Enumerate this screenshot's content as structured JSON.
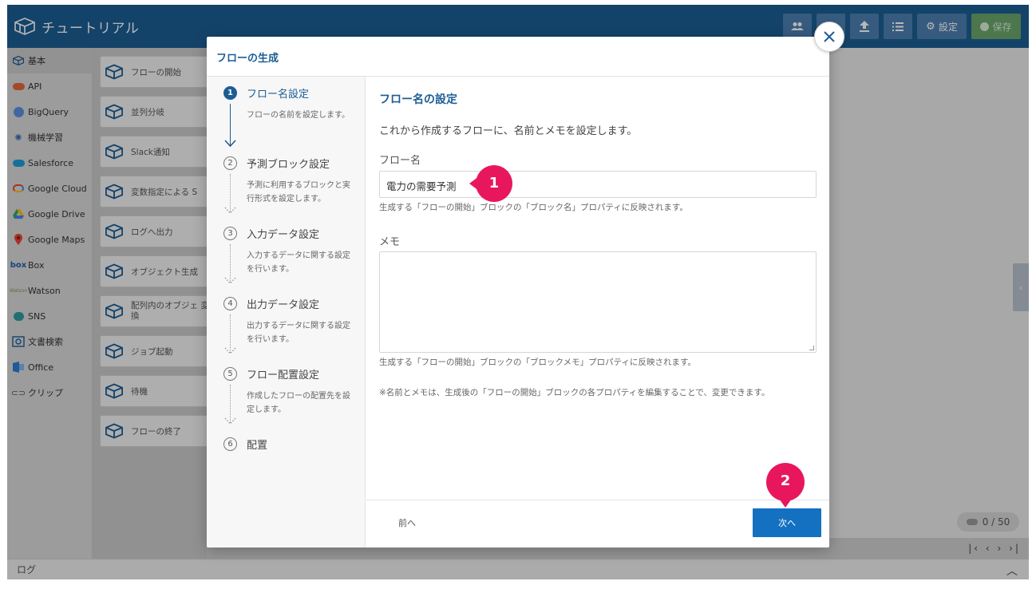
{
  "app": {
    "title": "チュートリアル",
    "toolbar": {
      "settings_label": "設定",
      "save_label": "保存"
    }
  },
  "sidebar": {
    "categories": [
      {
        "label": "基本",
        "icon": "hex-logo-icon"
      },
      {
        "label": "API",
        "icon": "cloud-api-icon"
      },
      {
        "label": "BigQuery",
        "icon": "bigquery-icon"
      },
      {
        "label": "機械学習",
        "icon": "brain-icon"
      },
      {
        "label": "Salesforce",
        "icon": "salesforce-cloud-icon"
      },
      {
        "label": "Google Cloud",
        "icon": "google-cloud-icon"
      },
      {
        "label": "Google Drive",
        "icon": "google-drive-icon"
      },
      {
        "label": "Google Maps",
        "icon": "map-pin-icon"
      },
      {
        "label": "Box",
        "icon": "box-icon"
      },
      {
        "label": "Watson",
        "icon": "watson-icon"
      },
      {
        "label": "SNS",
        "icon": "chat-bubble-icon"
      },
      {
        "label": "文書検索",
        "icon": "document-search-icon"
      },
      {
        "label": "Office",
        "icon": "office-icon"
      },
      {
        "label": "クリップ",
        "icon": "clip-icon"
      }
    ]
  },
  "blocks": [
    {
      "label": "フローの開始"
    },
    {
      "label": "並列分岐"
    },
    {
      "label": "Slack通知"
    },
    {
      "label": "変数指定による S"
    },
    {
      "label": "ログへ出力"
    },
    {
      "label": "オブジェクト生成"
    },
    {
      "label": "配列内のオブジェ 変換"
    },
    {
      "label": "ジョブ起動"
    },
    {
      "label": "待機"
    },
    {
      "label": "フローの終了"
    }
  ],
  "canvas": {
    "counter": "0 / 50"
  },
  "logbar": {
    "label": "ログ"
  },
  "modal": {
    "title": "フローの生成",
    "steps": [
      {
        "num": "1",
        "title": "フロー名設定",
        "desc": "フローの名前を設定します。"
      },
      {
        "num": "2",
        "title": "予測ブロック設定",
        "desc": "予測に利用するブロックと実行形式を設定します。"
      },
      {
        "num": "3",
        "title": "入力データ設定",
        "desc": "入力するデータに関する設定を行います。"
      },
      {
        "num": "4",
        "title": "出力データ設定",
        "desc": "出力するデータに関する設定を行います。"
      },
      {
        "num": "5",
        "title": "フロー配置設定",
        "desc": "作成したフローの配置先を設定します。"
      },
      {
        "num": "6",
        "title": "配置",
        "desc": ""
      }
    ],
    "section_title": "フロー名の設定",
    "section_desc": "これから作成するフローに、名前とメモを設定します。",
    "name_label": "フロー名",
    "name_value": "電力の需要予測",
    "name_hint": "生成する「フローの開始」ブロックの「ブロック名」プロパティに反映されます。",
    "memo_label": "メモ",
    "memo_hint": "生成する「フローの開始」ブロックの「ブロックメモ」プロパティに反映されます。",
    "note": "※名前とメモは、生成後の「フローの開始」ブロックの各プロパティを編集することで、変更できます。",
    "prev_label": "前へ",
    "next_label": "次へ"
  },
  "callouts": [
    {
      "num": "1"
    },
    {
      "num": "2"
    }
  ],
  "colors": {
    "primary": "#1c5d94",
    "button": "#1470c0",
    "callout": "#e8175d"
  }
}
